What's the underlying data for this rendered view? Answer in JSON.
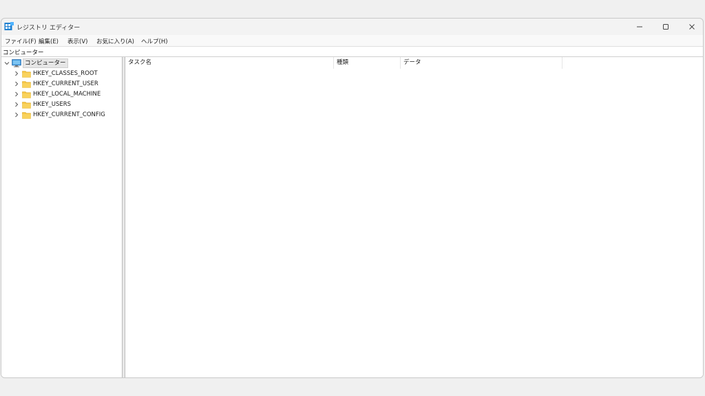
{
  "window": {
    "title": "レジストリ エディター"
  },
  "menu": [
    "ファイル(F)",
    "編集(E)",
    "表示(V)",
    "お気に入り(A)",
    "ヘルプ(H)"
  ],
  "address": "コンピューター",
  "tree": {
    "root": "コンピューター",
    "children": [
      "HKEY_CLASSES_ROOT",
      "HKEY_CURRENT_USER",
      "HKEY_LOCAL_MACHINE",
      "HKEY_USERS",
      "HKEY_CURRENT_CONFIG"
    ]
  },
  "list": {
    "columns": [
      "タスク名",
      "種類",
      "データ"
    ]
  },
  "colors": {
    "folder": "#f6c544",
    "app_icon": "#1e7fd0",
    "selection": "#e6e6e6"
  },
  "icons": [
    "registry-editor-icon",
    "minimize-icon",
    "maximize-icon",
    "close-icon",
    "chevron-down-icon",
    "chevron-right-icon",
    "computer-icon",
    "folder-icon"
  ]
}
